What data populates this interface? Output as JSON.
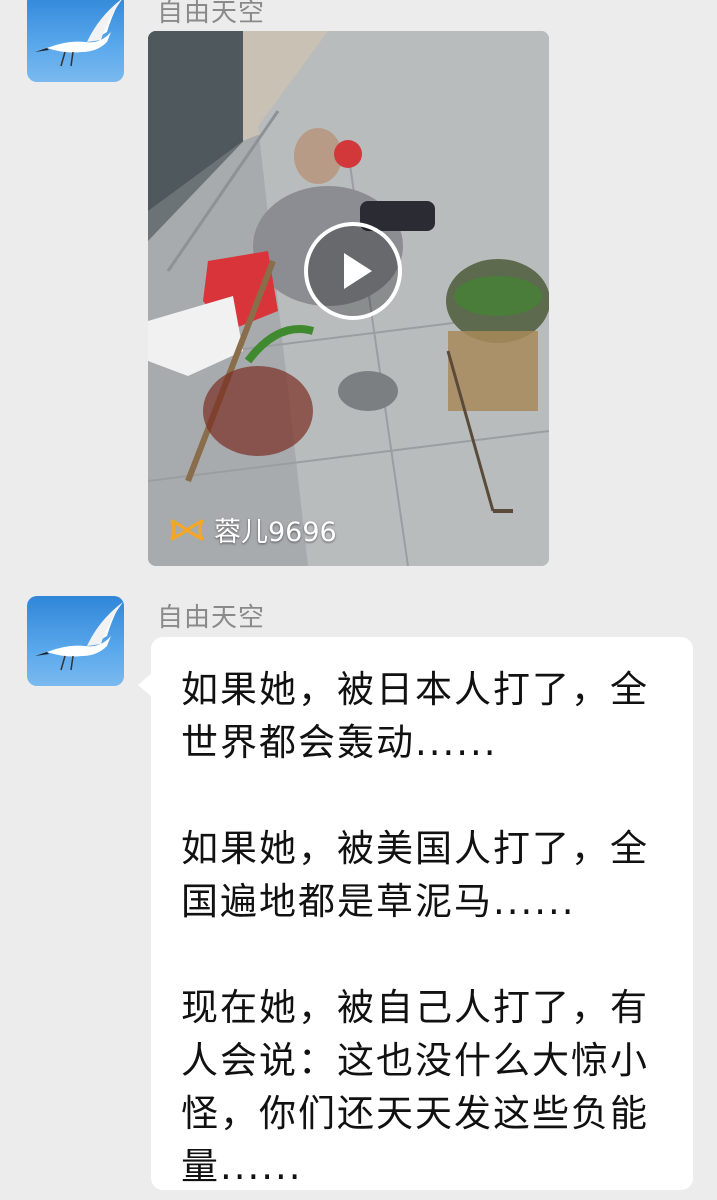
{
  "messages": [
    {
      "sender": "自由天空",
      "avatar_icon": "crane-icon",
      "type": "video",
      "video": {
        "watermark_icon": "kuaishou-logo-icon",
        "watermark_text": "蓉儿9696"
      }
    },
    {
      "sender": "自由天空",
      "avatar_icon": "crane-icon",
      "type": "text",
      "paragraphs": [
        "如果她，被日本人打了，全世界都会轰动......",
        "如果她，被美国人打了，全国遍地都是草泥马......",
        "现在她，被自己人打了，有人会说：这也没什么大惊小怪，你们还天天发这些负能量......"
      ]
    }
  ],
  "colors": {
    "background": "#ececec",
    "bubble": "#ffffff",
    "sender_name": "#8a8a8a",
    "watermark_logo": "#f5a623"
  }
}
